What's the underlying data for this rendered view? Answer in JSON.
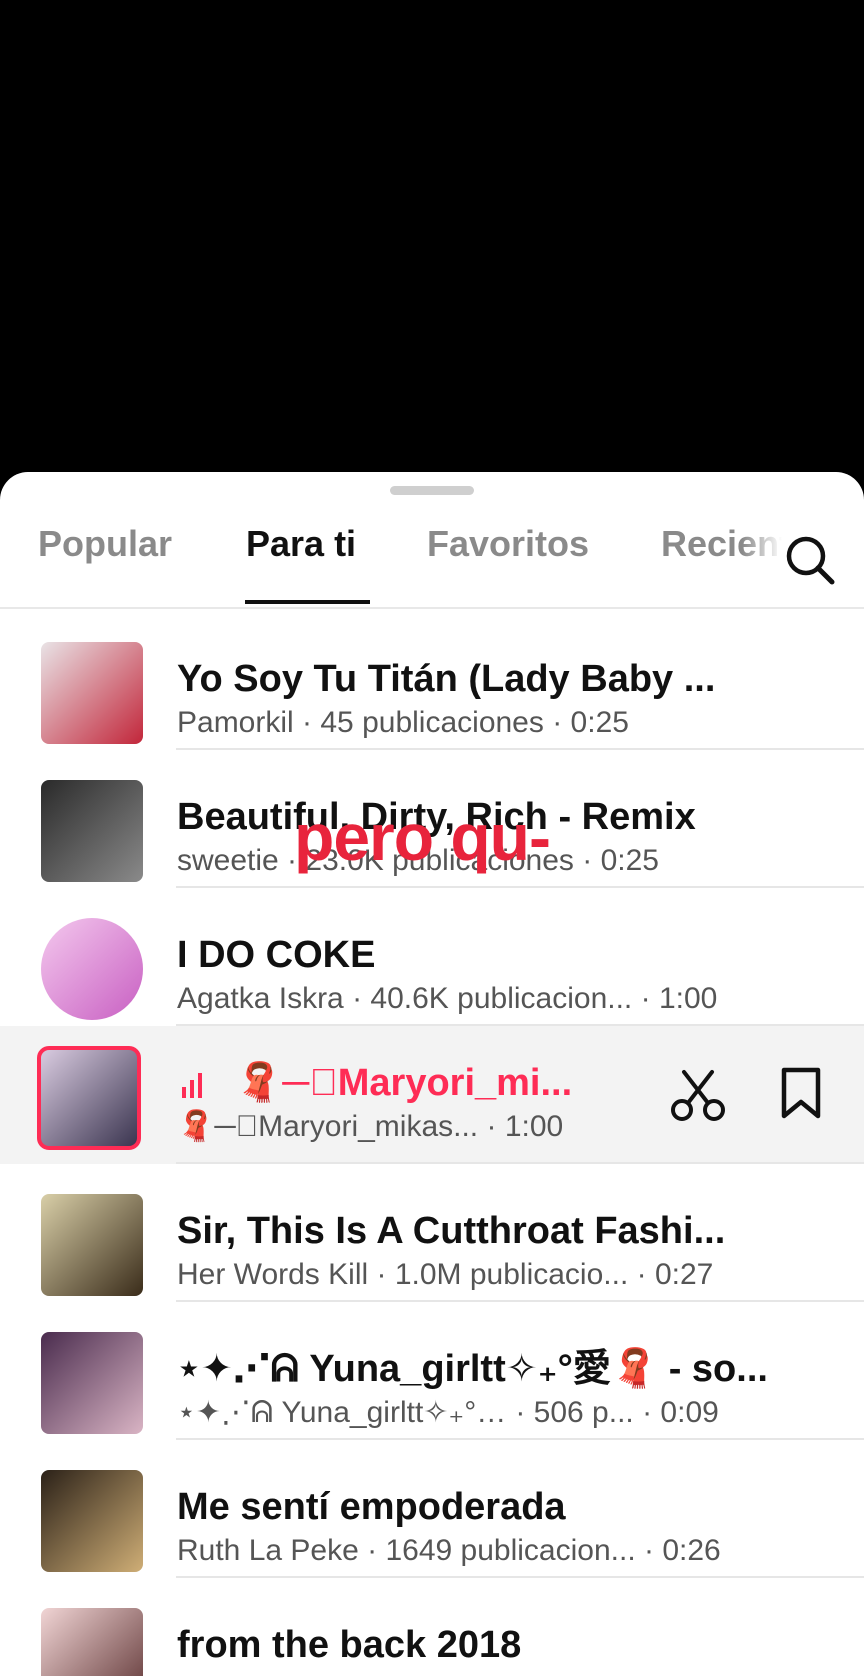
{
  "tabs": [
    "Popular",
    "Para ti",
    "Favoritos",
    "Recientes"
  ],
  "active_tab": "Para ti",
  "overlay_text": "pero qu-",
  "songs": [
    {
      "title": "Yo Soy Tu Titán (Lady Baby ...",
      "artist": "Pamorkil",
      "posts": "45 publicaciones",
      "duration": "0:25",
      "thumb_colors": [
        "#e9e3e6",
        "#c2263a"
      ]
    },
    {
      "title": "Beautiful, Dirty, Rich - Remix",
      "artist": "sweetie",
      "posts": "23.0K publicaciones",
      "duration": "0:25",
      "thumb_colors": [
        "#2a2a2a",
        "#8a8a8a"
      ]
    },
    {
      "title": "I DO COKE",
      "artist": "Agatka Iskra",
      "posts": "40.6K publicacion...",
      "duration": "1:00",
      "thumb_colors": [
        "#f4c9ee",
        "#c85fc2"
      ]
    },
    {
      "title": "🧣─⃞Maryori_mi...",
      "artist": "🧣─⃞Maryori_mikas...",
      "posts": "",
      "duration": "1:00",
      "thumb_colors": [
        "#d9cbe0",
        "#3b3550"
      ],
      "selected": true
    },
    {
      "title": "Sir, This Is A Cutthroat Fashi...",
      "artist": "Her Words Kill",
      "posts": "1.0M publicacio...",
      "duration": "0:27",
      "thumb_colors": [
        "#d9cfa8",
        "#3a2c1a"
      ]
    },
    {
      "title": "⋆✦⋰ᕱ Yuna_girltt✧₊°愛🧣 - so...",
      "artist": "⋆✦⋰ᕱ Yuna_girltt✧₊°愛🧣",
      "posts": "506 p...",
      "duration": "0:09",
      "thumb_colors": [
        "#4a2c4e",
        "#d9b4c4"
      ]
    },
    {
      "title": "Me sentí empoderada",
      "artist": "Ruth La Peke",
      "posts": "1649 publicacion...",
      "duration": "0:26",
      "thumb_colors": [
        "#2b2118",
        "#cfae76"
      ]
    },
    {
      "title": "from the back 2018",
      "artist": "",
      "posts": "",
      "duration": "",
      "thumb_colors": [
        "#f1d5d5",
        "#5a2f2f"
      ]
    }
  ],
  "colors": {
    "accent": "#fe2c55",
    "overlay": "#e8243c"
  }
}
